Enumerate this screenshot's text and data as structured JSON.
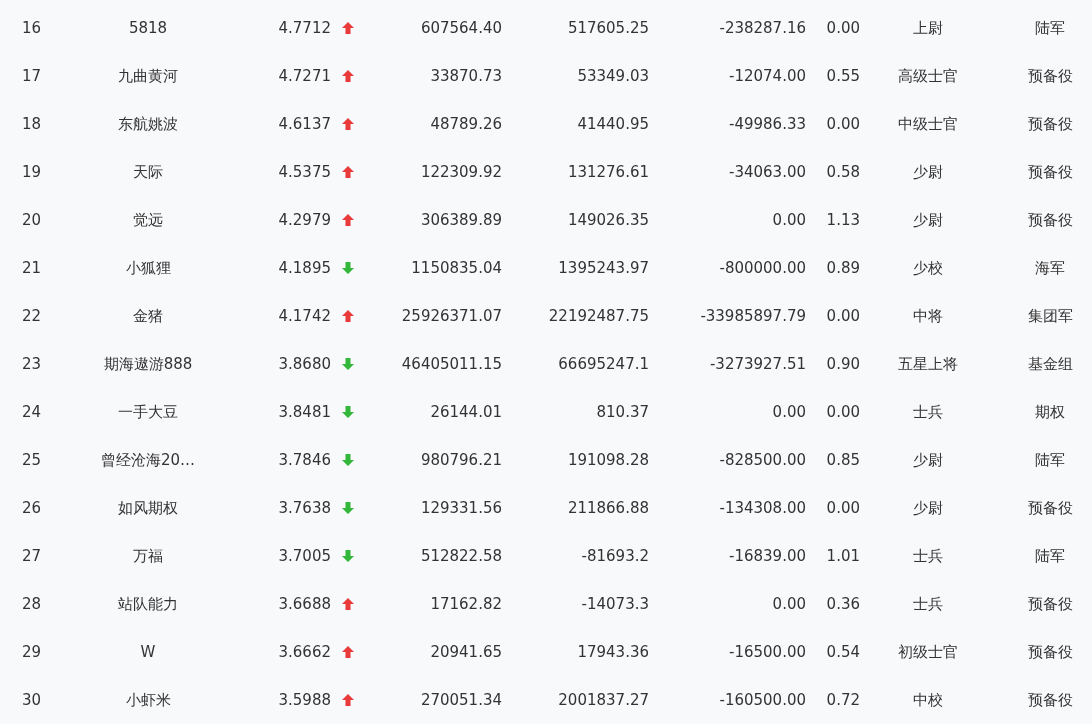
{
  "rows": [
    {
      "rank": "16",
      "name": "5818",
      "score": "4.7712",
      "rising": true,
      "col_4": "607564.40",
      "col_5": "517605.25",
      "col_6": "-238287.16",
      "col_7": "0.00",
      "rank_title": "上尉",
      "group": "陆军"
    },
    {
      "rank": "17",
      "name": "九曲黄河",
      "score": "4.7271",
      "rising": true,
      "col_4": "33870.73",
      "col_5": "53349.03",
      "col_6": "-12074.00",
      "col_7": "0.55",
      "rank_title": "高级士官",
      "group": "预备役"
    },
    {
      "rank": "18",
      "name": "东航姚波",
      "score": "4.6137",
      "rising": true,
      "col_4": "48789.26",
      "col_5": "41440.95",
      "col_6": "-49986.33",
      "col_7": "0.00",
      "rank_title": "中级士官",
      "group": "预备役"
    },
    {
      "rank": "19",
      "name": "天际",
      "score": "4.5375",
      "rising": true,
      "col_4": "122309.92",
      "col_5": "131276.61",
      "col_6": "-34063.00",
      "col_7": "0.58",
      "rank_title": "少尉",
      "group": "预备役"
    },
    {
      "rank": "20",
      "name": "觉远",
      "score": "4.2979",
      "rising": true,
      "col_4": "306389.89",
      "col_5": "149026.35",
      "col_6": "0.00",
      "col_7": "1.13",
      "rank_title": "少尉",
      "group": "预备役"
    },
    {
      "rank": "21",
      "name": "小狐狸",
      "score": "4.1895",
      "rising": false,
      "col_4": "1150835.04",
      "col_5": "1395243.97",
      "col_6": "-800000.00",
      "col_7": "0.89",
      "rank_title": "少校",
      "group": "海军"
    },
    {
      "rank": "22",
      "name": "金猪",
      "score": "4.1742",
      "rising": true,
      "col_4": "25926371.07",
      "col_5": "22192487.75",
      "col_6": "-33985897.79",
      "col_7": "0.00",
      "rank_title": "中将",
      "group": "集团军"
    },
    {
      "rank": "23",
      "name": "期海遨游888",
      "score": "3.8680",
      "rising": false,
      "col_4": "46405011.15",
      "col_5": "66695247.1",
      "col_6": "-3273927.51",
      "col_7": "0.90",
      "rank_title": "五星上将",
      "group": "基金组"
    },
    {
      "rank": "24",
      "name": "一手大豆",
      "score": "3.8481",
      "rising": false,
      "col_4": "26144.01",
      "col_5": "810.37",
      "col_6": "0.00",
      "col_7": "0.00",
      "rank_title": "士兵",
      "group": "期权"
    },
    {
      "rank": "25",
      "name": "曾经沧海20…",
      "score": "3.7846",
      "rising": false,
      "col_4": "980796.21",
      "col_5": "191098.28",
      "col_6": "-828500.00",
      "col_7": "0.85",
      "rank_title": "少尉",
      "group": "陆军"
    },
    {
      "rank": "26",
      "name": "如风期权",
      "score": "3.7638",
      "rising": false,
      "col_4": "129331.56",
      "col_5": "211866.88",
      "col_6": "-134308.00",
      "col_7": "0.00",
      "rank_title": "少尉",
      "group": "预备役"
    },
    {
      "rank": "27",
      "name": "万福",
      "score": "3.7005",
      "rising": false,
      "col_4": "512822.58",
      "col_5": "-81693.2",
      "col_6": "-16839.00",
      "col_7": "1.01",
      "rank_title": "士兵",
      "group": "陆军"
    },
    {
      "rank": "28",
      "name": "站队能力",
      "score": "3.6688",
      "rising": true,
      "col_4": "17162.82",
      "col_5": "-14073.3",
      "col_6": "0.00",
      "col_7": "0.36",
      "rank_title": "士兵",
      "group": "预备役"
    },
    {
      "rank": "29",
      "name": "W",
      "score": "3.6662",
      "rising": true,
      "col_4": "20941.65",
      "col_5": "17943.36",
      "col_6": "-16500.00",
      "col_7": "0.54",
      "rank_title": "初级士官",
      "group": "预备役"
    },
    {
      "rank": "30",
      "name": "小虾米",
      "score": "3.5988",
      "rising": true,
      "col_4": "270051.34",
      "col_5": "2001837.27",
      "col_6": "-160500.00",
      "col_7": "0.72",
      "rank_title": "中校",
      "group": "预备役"
    }
  ]
}
